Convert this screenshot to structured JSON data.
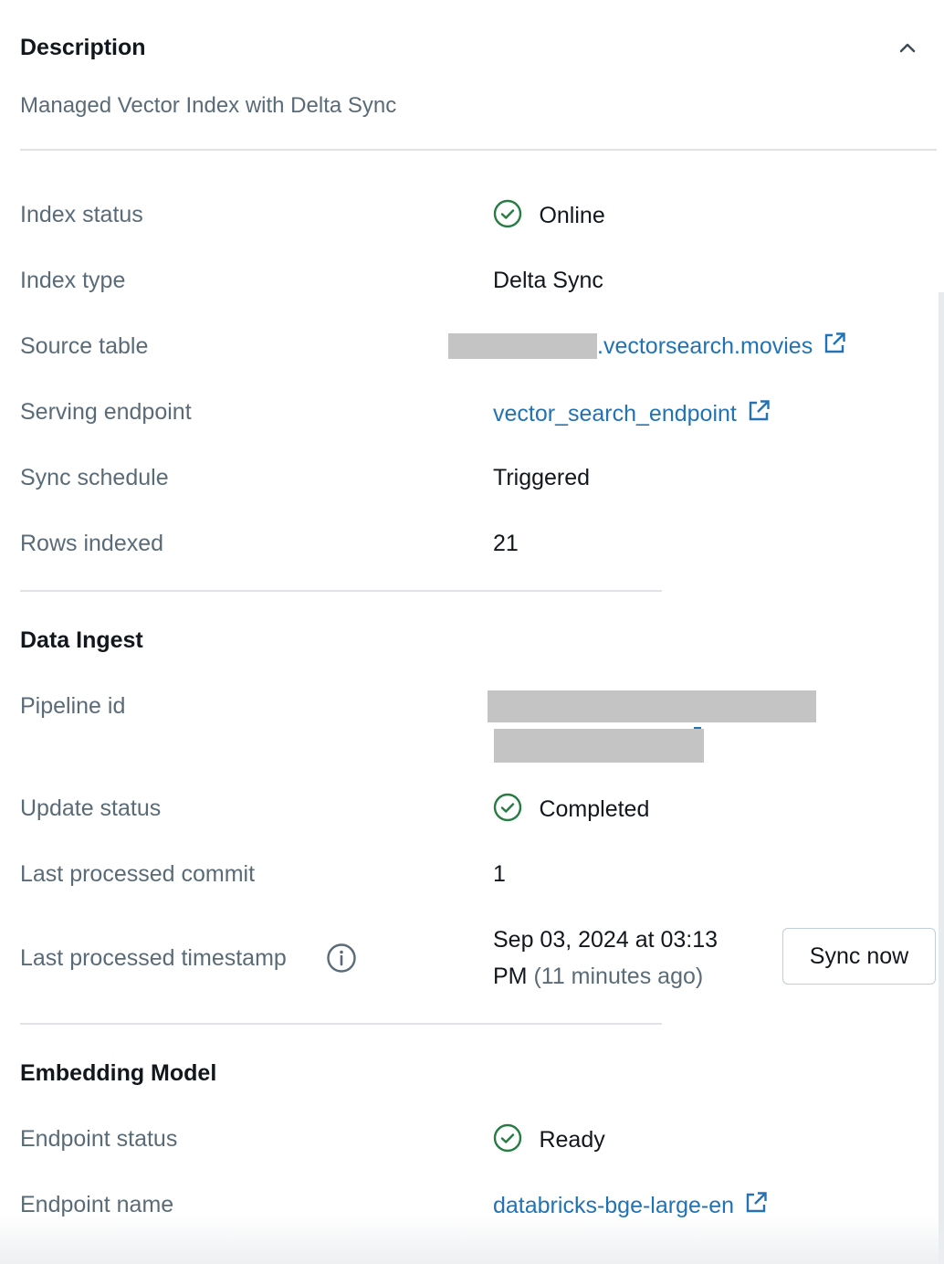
{
  "description": {
    "heading": "Description",
    "text": "Managed Vector Index with Delta Sync"
  },
  "index_details": {
    "index_status": {
      "label": "Index status",
      "value": "Online"
    },
    "index_type": {
      "label": "Index type",
      "value": "Delta Sync"
    },
    "source_table": {
      "label": "Source table",
      "value": ".vectorsearch.movies"
    },
    "serving_endpoint": {
      "label": "Serving endpoint",
      "value": "vector_search_endpoint"
    },
    "sync_schedule": {
      "label": "Sync schedule",
      "value": "Triggered"
    },
    "rows_indexed": {
      "label": "Rows indexed",
      "value": "21"
    }
  },
  "data_ingest": {
    "heading": "Data Ingest",
    "pipeline_id": {
      "label": "Pipeline id"
    },
    "update_status": {
      "label": "Update status",
      "value": "Completed"
    },
    "last_processed_commit": {
      "label": "Last processed commit",
      "value": "1"
    },
    "last_processed_timestamp": {
      "label": "Last processed timestamp",
      "value_line1": "Sep 03, 2024 at 03:13",
      "value_line2": "PM",
      "relative": "(11 minutes ago)"
    },
    "sync_button": "Sync now"
  },
  "embedding_model": {
    "heading": "Embedding Model",
    "endpoint_status": {
      "label": "Endpoint status",
      "value": "Ready"
    },
    "endpoint_name": {
      "label": "Endpoint name",
      "value": "databricks-bge-large-en"
    }
  },
  "colors": {
    "link": "#2272b4",
    "success": "#277c43",
    "label": "#5a6b78",
    "text": "#11171c"
  },
  "icons": [
    "chevron-up-icon",
    "check-circle-icon",
    "external-link-icon",
    "info-icon"
  ]
}
